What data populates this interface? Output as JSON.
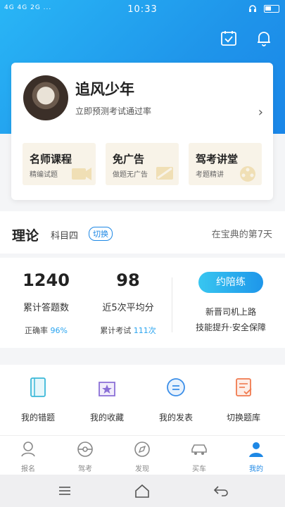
{
  "status": {
    "signal": "4G 4G 2G ...",
    "time": "10:33"
  },
  "profile": {
    "name": "追风少年",
    "subtitle": "立即预测考试通过率",
    "features": [
      {
        "title": "名师课程",
        "sub": "精编试题"
      },
      {
        "title": "免广告",
        "sub": "做题无广告"
      },
      {
        "title": "驾考讲堂",
        "sub": "考题精讲"
      }
    ]
  },
  "theory": {
    "title": "理论",
    "subject": "科目四",
    "switch": "切换",
    "days": "在宝典的第7天"
  },
  "stats": {
    "answered": {
      "num": "1240",
      "label": "累计答题数",
      "sub_prefix": "正确率",
      "sub_value": "96%"
    },
    "average": {
      "num": "98",
      "label": "近5次平均分",
      "sub_prefix": "累计考试",
      "sub_value": "111次"
    },
    "cta": {
      "button": "约陪练",
      "line1": "新晋司机上路",
      "line2": "技能提升·安全保障"
    }
  },
  "quick": [
    "我的错题",
    "我的收藏",
    "我的发表",
    "切换题库"
  ],
  "tabs": [
    "报名",
    "驾考",
    "发现",
    "买车",
    "我的"
  ],
  "colors": {
    "accent": "#1e88e5",
    "hero": "#29b6f6"
  }
}
